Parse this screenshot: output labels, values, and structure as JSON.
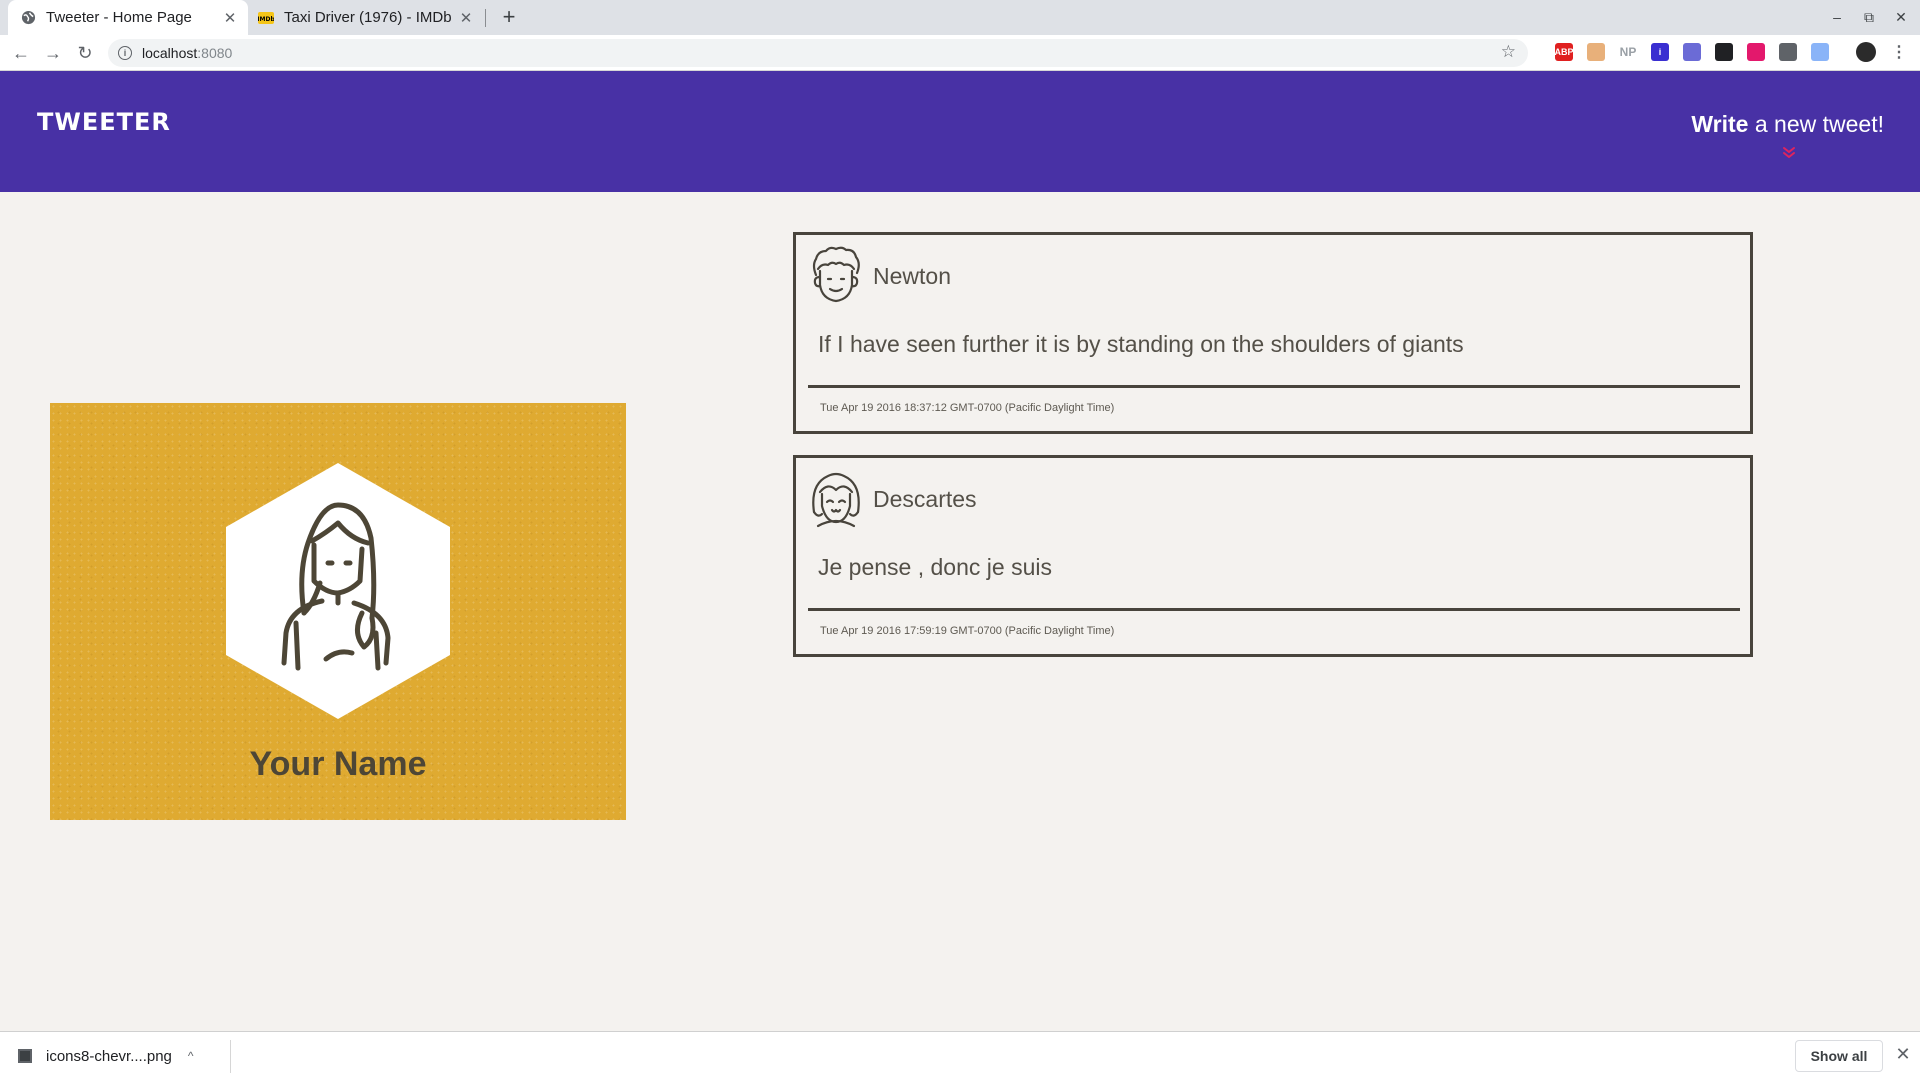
{
  "browser": {
    "tabs": [
      {
        "title": "Tweeter - Home Page",
        "active": true,
        "favicon": "globe-icon"
      },
      {
        "title": "Taxi Driver (1976) - IMDb",
        "active": false,
        "favicon": "imdb-icon"
      }
    ],
    "url_host": "localhost",
    "url_port": ":8080",
    "extensions": [
      {
        "name": "adblock-extension-icon",
        "label": "ABP",
        "color": "#e02020"
      },
      {
        "name": "face-extension-icon",
        "label": "",
        "color": "#e8b07a"
      },
      {
        "name": "np-extension-icon",
        "label": "NP",
        "color": "#9aa0a6"
      },
      {
        "name": "info-extension-icon",
        "label": "i",
        "color": "#3a2fd1"
      },
      {
        "name": "ghost-extension-icon",
        "label": "",
        "color": "#6b6bd6"
      },
      {
        "name": "pip-extension-icon",
        "label": "",
        "color": "#202124"
      },
      {
        "name": "moon-extension-icon",
        "label": "",
        "color": "#e3186c"
      },
      {
        "name": "sync-extension-icon",
        "label": "",
        "color": "#5f6368"
      },
      {
        "name": "compass-extension-icon",
        "label": "",
        "color": "#8ab4f8"
      }
    ]
  },
  "header": {
    "brand": "TWEETER",
    "compose_bold": "Write",
    "compose_rest": " a new tweet!",
    "accent": "#4831a5",
    "chevron_color": "#e0245e"
  },
  "profile": {
    "name": "Your Name",
    "background": "#dfaa31"
  },
  "tweets": [
    {
      "author": "Newton",
      "avatar": "curly-hair-man-avatar-icon",
      "text": "If I have seen further it is by standing on the shoulders of giants",
      "timestamp": "Tue Apr 19 2016 18:37:12 GMT-0700 (Pacific Daylight Time)"
    },
    {
      "author": "Descartes",
      "avatar": "bob-hair-avatar-icon",
      "text": "Je pense , donc je suis",
      "timestamp": "Tue Apr 19 2016 17:59:19 GMT-0700 (Pacific Daylight Time)"
    }
  ],
  "downloads": {
    "file": "icons8-chevr....png",
    "show_all": "Show all"
  }
}
